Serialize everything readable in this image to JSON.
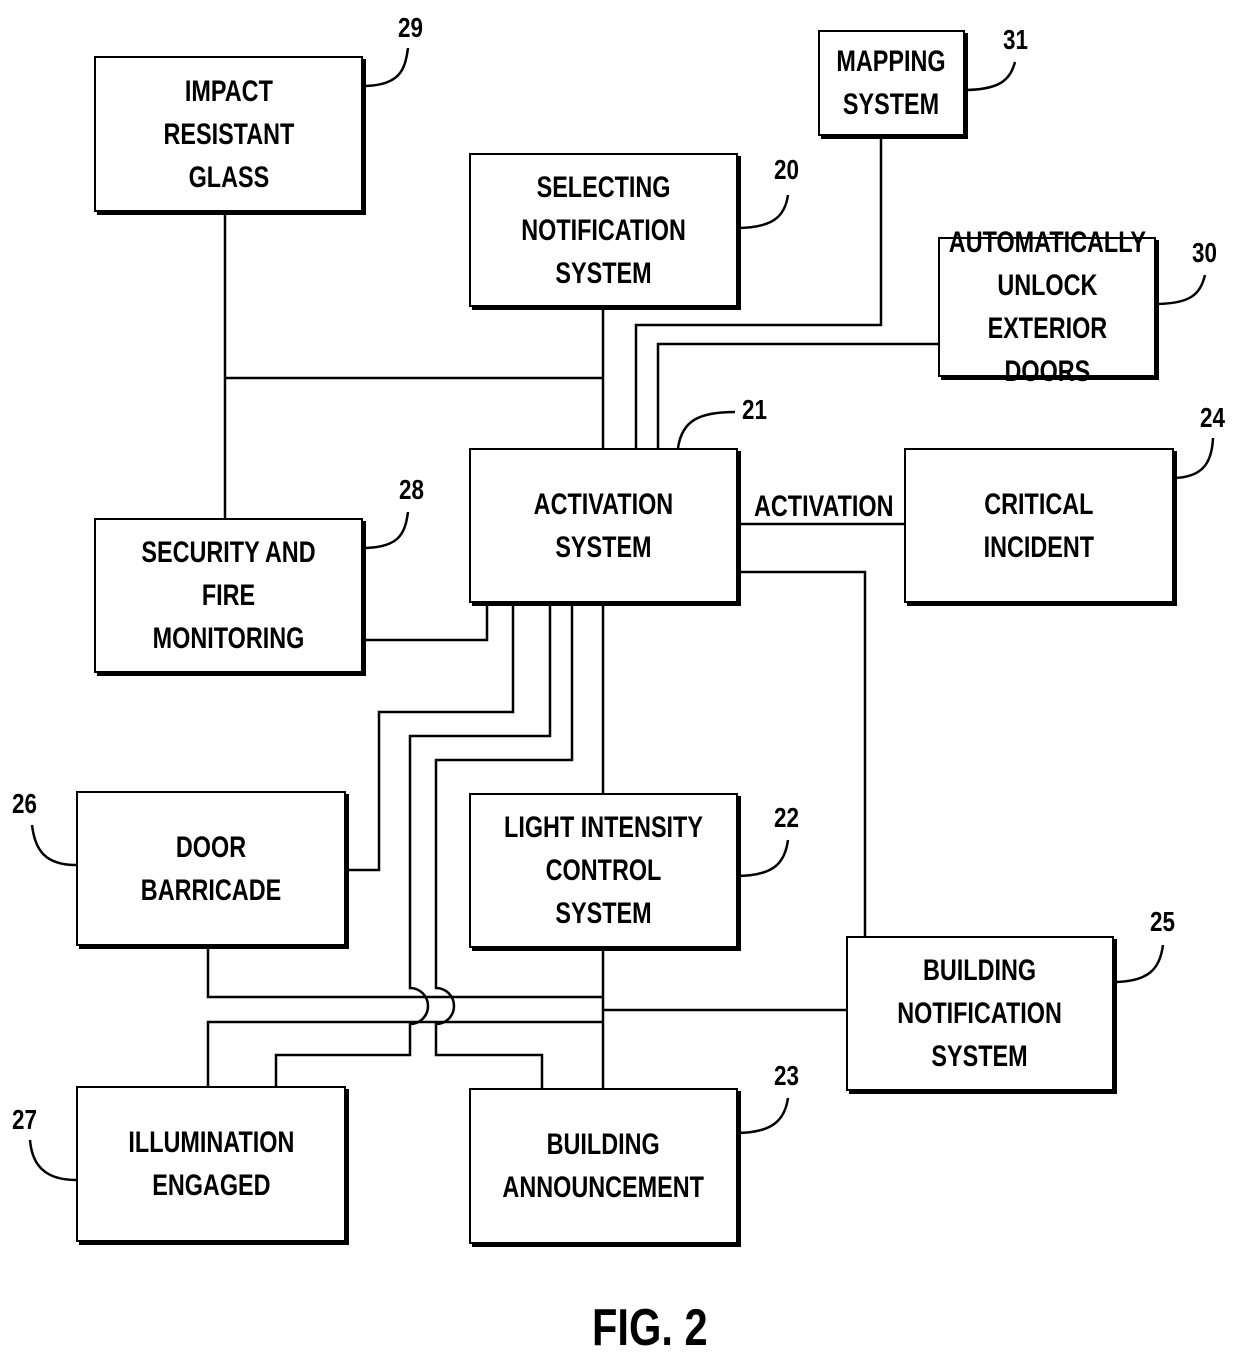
{
  "figure_label": "FIG. 2",
  "edge_labels": {
    "activation": "ACTIVATION"
  },
  "blocks": {
    "impact_resistant_glass": {
      "label": "IMPACT\nRESISTANT\nGLASS",
      "ref": "29"
    },
    "mapping_system": {
      "label": "MAPPING\nSYSTEM",
      "ref": "31"
    },
    "selecting_notification_system": {
      "label": "SELECTING\nNOTIFICATION\nSYSTEM",
      "ref": "20"
    },
    "automatically_unlock_exterior_doors": {
      "label": "AUTOMATICALLY\nUNLOCK\nEXTERIOR DOORS",
      "ref": "30"
    },
    "activation_system": {
      "label": "ACTIVATION\nSYSTEM",
      "ref": "21"
    },
    "critical_incident": {
      "label": "CRITICAL\nINCIDENT",
      "ref": "24"
    },
    "security_and_fire_monitoring": {
      "label": "SECURITY AND\nFIRE MONITORING",
      "ref": "28"
    },
    "door_barricade": {
      "label": "DOOR\nBARRICADE",
      "ref": "26"
    },
    "light_intensity_control_system": {
      "label": "LIGHT INTENSITY\nCONTROL SYSTEM",
      "ref": "22"
    },
    "building_notification_system": {
      "label": "BUILDING\nNOTIFICATION\nSYSTEM",
      "ref": "25"
    },
    "illumination_engaged": {
      "label": "ILLUMINATION\nENGAGED",
      "ref": "27"
    },
    "building_announcement": {
      "label": "BUILDING\nANNOUNCEMENT",
      "ref": "23"
    }
  }
}
